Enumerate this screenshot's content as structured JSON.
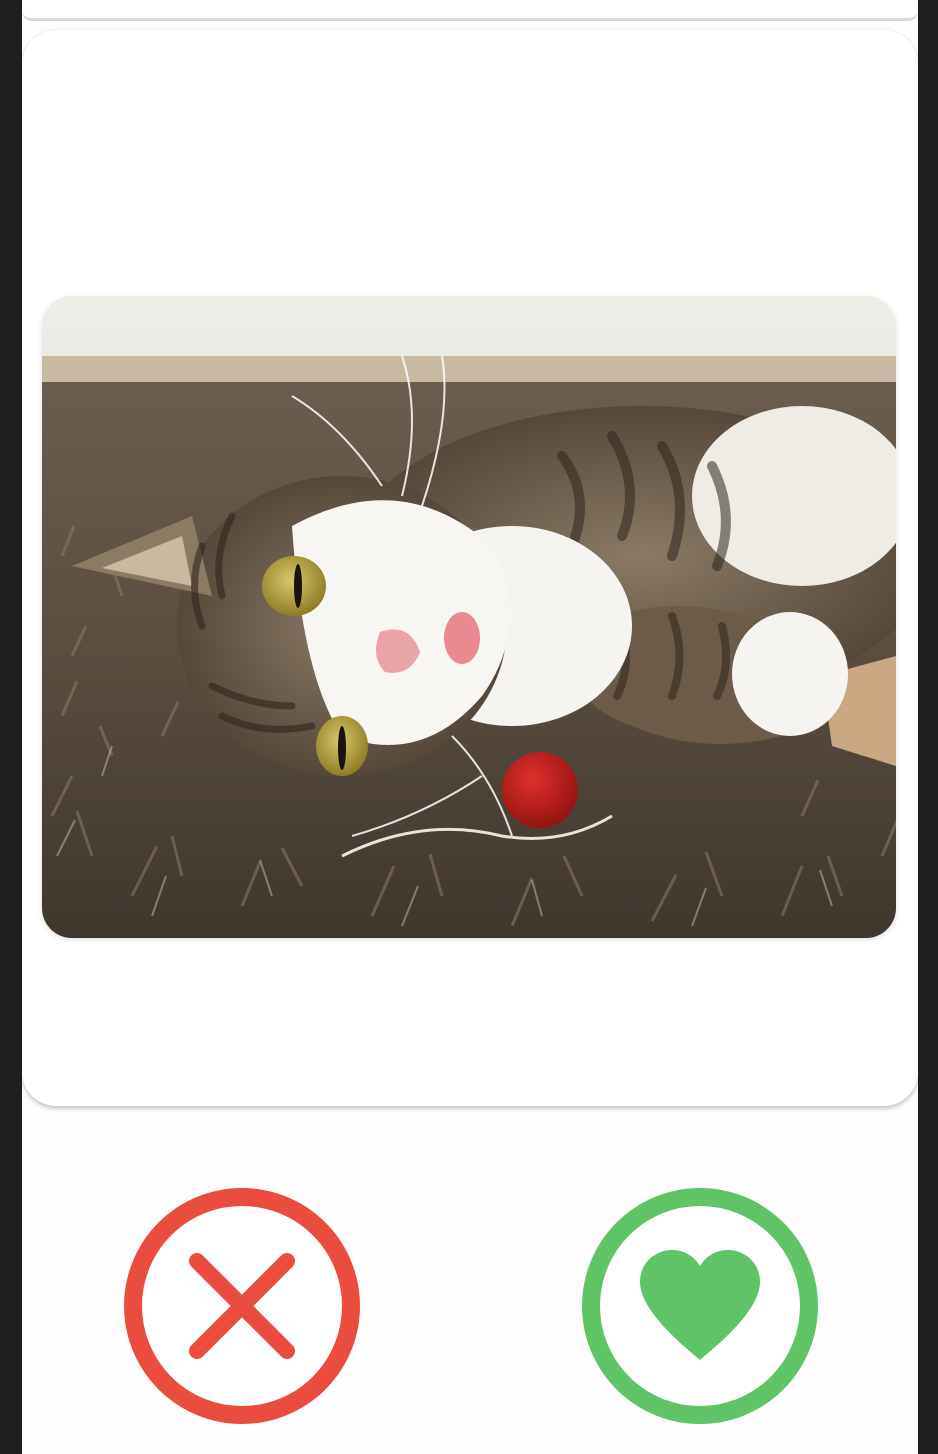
{
  "card": {
    "photo": {
      "subject": "tabby-cat-image"
    }
  },
  "actions": {
    "dislike": {
      "icon": "close-icon",
      "color": "#ea4d3d"
    },
    "like": {
      "icon": "heart-icon",
      "color": "#5fc466"
    }
  }
}
